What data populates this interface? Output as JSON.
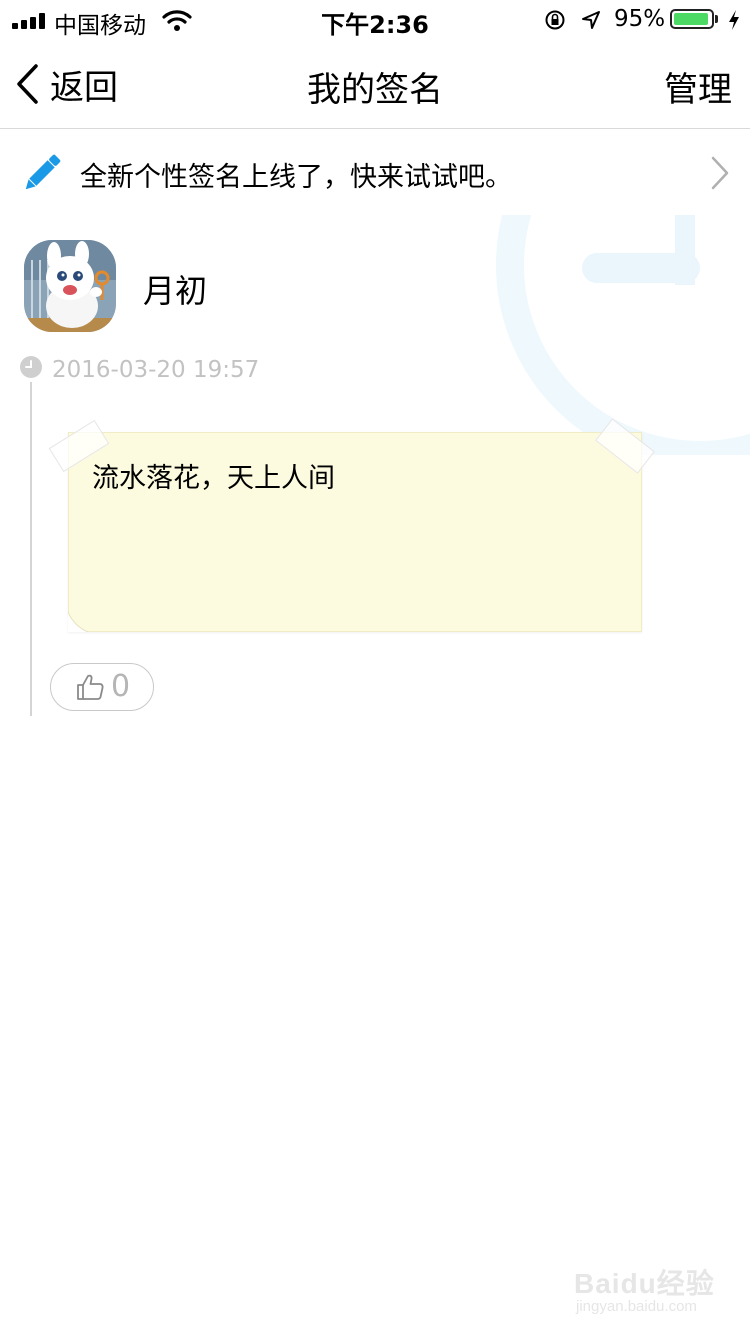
{
  "status_bar": {
    "carrier": "中国移动",
    "time": "下午2:36",
    "battery_percent": "95%",
    "battery_level": 0.95,
    "battery_color": "#4cd964"
  },
  "nav": {
    "back_label": "返回",
    "title": "我的签名",
    "manage_label": "管理"
  },
  "banner": {
    "icon": "pencil-icon",
    "text": "全新个性签名上线了，快来试试吧。",
    "icon_color": "#1a9ae6"
  },
  "profile": {
    "username": "月初"
  },
  "entry": {
    "timestamp": "2016-03-20 19:57",
    "signature": "流水落花，天上人间",
    "note_color": "#fdfbdf",
    "like_count": "0"
  },
  "watermark": {
    "logo": "Baidu经验",
    "url": "jingyan.baidu.com"
  }
}
